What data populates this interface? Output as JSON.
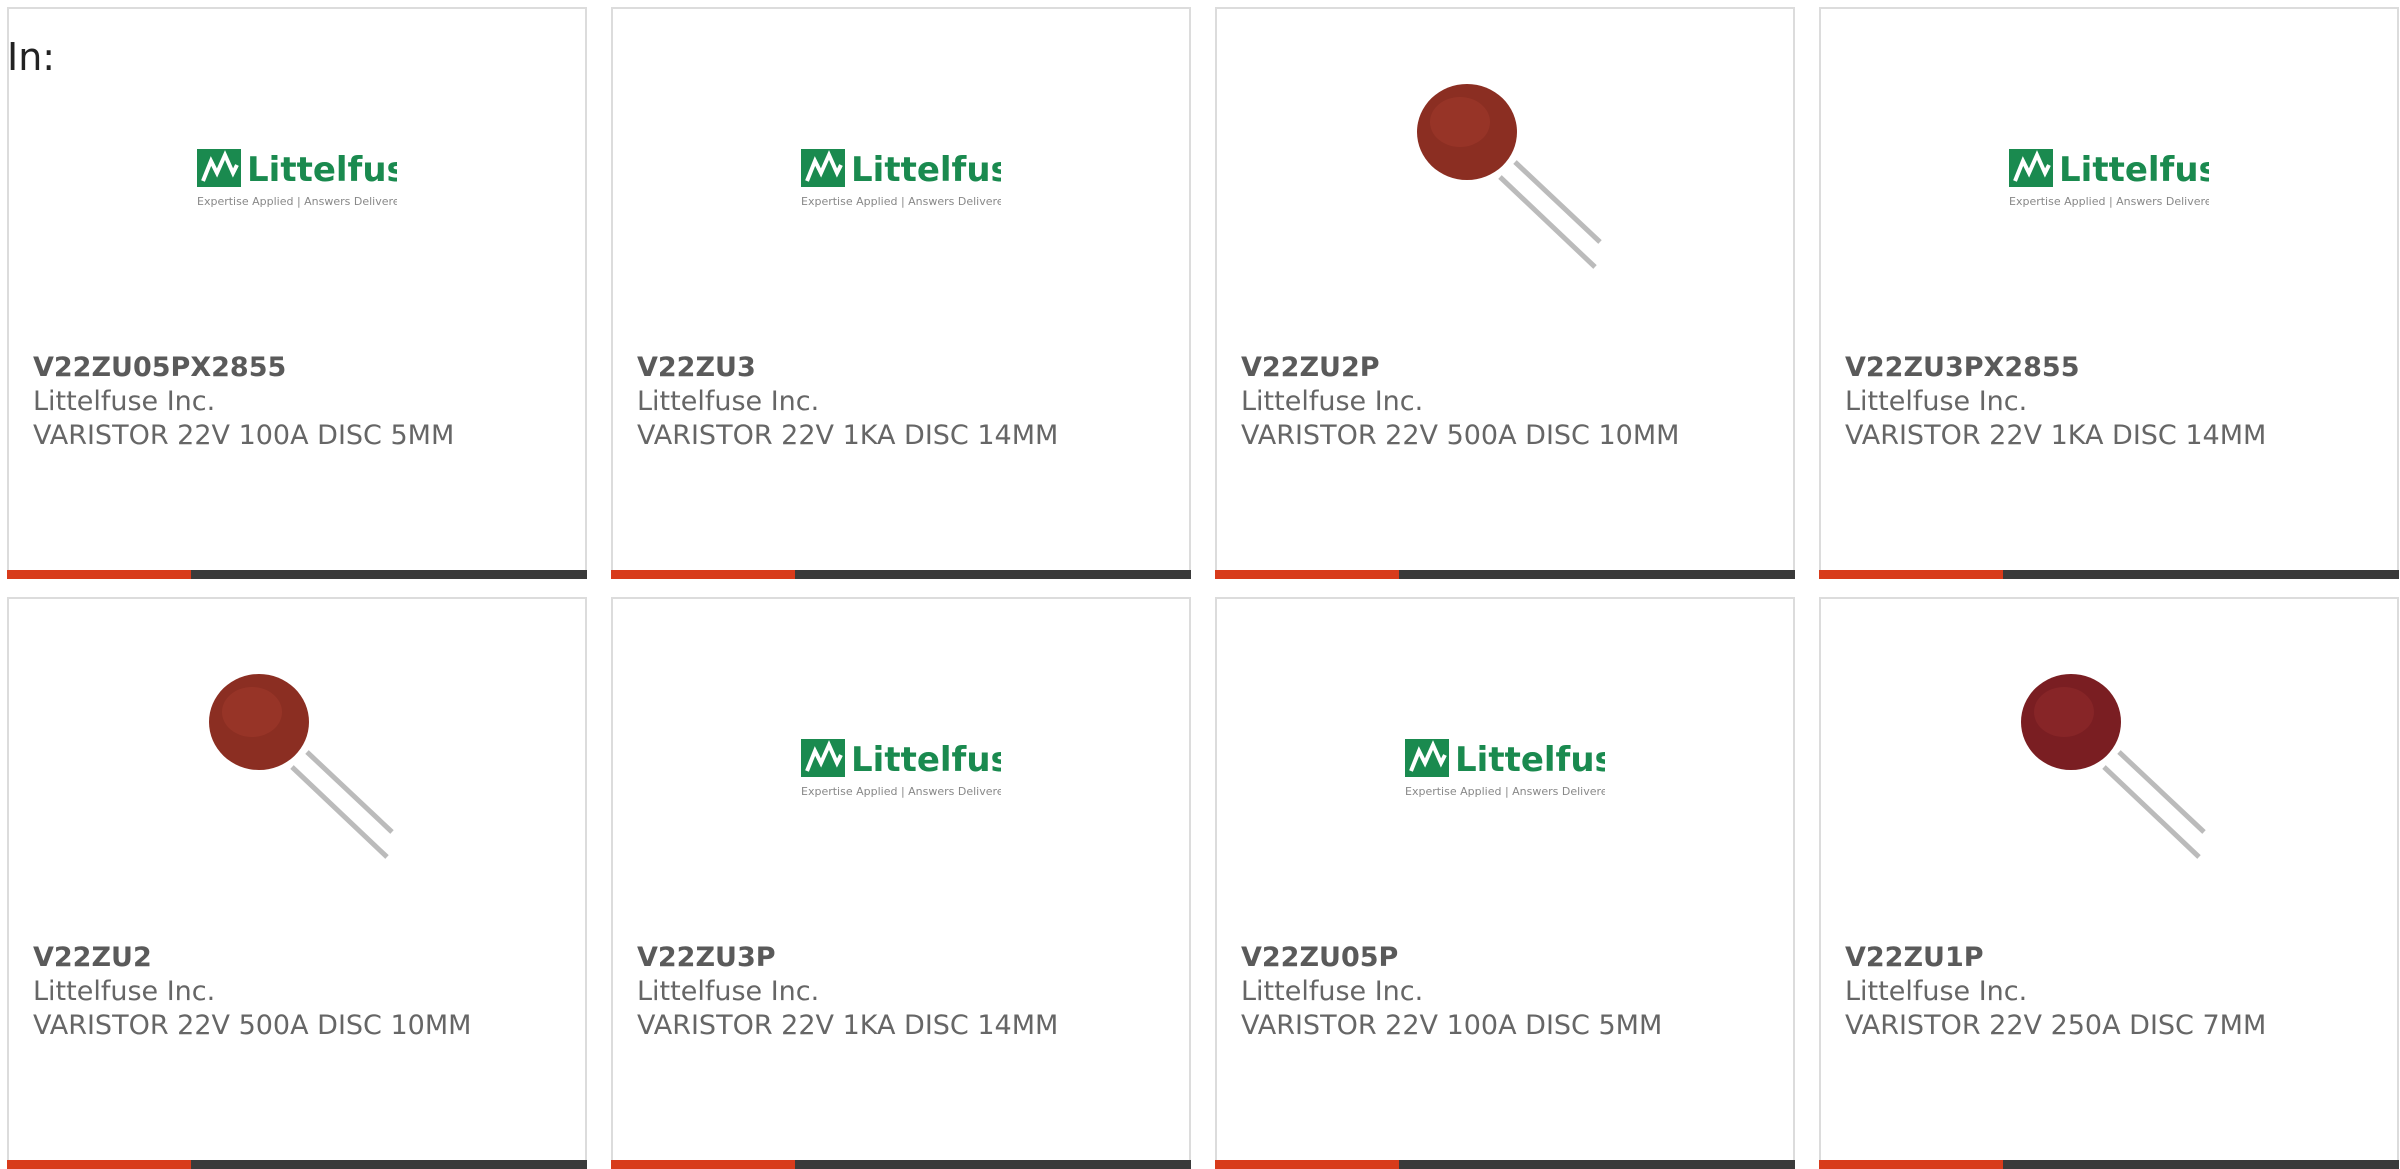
{
  "filter_label": "In:",
  "products": [
    {
      "part_number": "V22ZU05PX2855",
      "manufacturer": "Littelfuse Inc.",
      "description": "VARISTOR 22V 100A DISC 5MM",
      "image": "littelfuse-logo",
      "logo_text": "Littelfuse",
      "logo_tagline": "Expertise Applied | Answers Delivered"
    },
    {
      "part_number": "V22ZU3",
      "manufacturer": "Littelfuse Inc.",
      "description": "VARISTOR 22V 1KA DISC 14MM",
      "image": "littelfuse-logo",
      "logo_text": "Littelfuse",
      "logo_tagline": "Expertise Applied | Answers Delivered"
    },
    {
      "part_number": "V22ZU2P",
      "manufacturer": "Littelfuse Inc.",
      "description": "VARISTOR 22V 500A DISC 10MM",
      "image": "disc-varistor-photo"
    },
    {
      "part_number": "V22ZU3PX2855",
      "manufacturer": "Littelfuse Inc.",
      "description": "VARISTOR 22V 1KA DISC 14MM",
      "image": "littelfuse-logo",
      "logo_text": "Littelfuse",
      "logo_tagline": "Expertise Applied | Answers Delivered"
    },
    {
      "part_number": "V22ZU2",
      "manufacturer": "Littelfuse Inc.",
      "description": "VARISTOR 22V 500A DISC 10MM",
      "image": "disc-varistor-photo"
    },
    {
      "part_number": "V22ZU3P",
      "manufacturer": "Littelfuse Inc.",
      "description": "VARISTOR 22V 1KA DISC 14MM",
      "image": "littelfuse-logo",
      "logo_text": "Littelfuse",
      "logo_tagline": "Expertise Applied | Answers Delivered"
    },
    {
      "part_number": "V22ZU05P",
      "manufacturer": "Littelfuse Inc.",
      "description": "VARISTOR 22V 100A DISC 5MM",
      "image": "littelfuse-logo",
      "logo_text": "Littelfuse",
      "logo_tagline": "Expertise Applied | Answers Delivered"
    },
    {
      "part_number": "V22ZU1P",
      "manufacturer": "Littelfuse Inc.",
      "description": "VARISTOR 22V 250A DISC 7MM",
      "image": "disc-varistor-photo"
    }
  ],
  "colors": {
    "accent": "#d83b1b",
    "bar_dark": "#3a3a3a",
    "logo_green": "#1a8a4f",
    "varistor_brown": "#8b2e22"
  }
}
